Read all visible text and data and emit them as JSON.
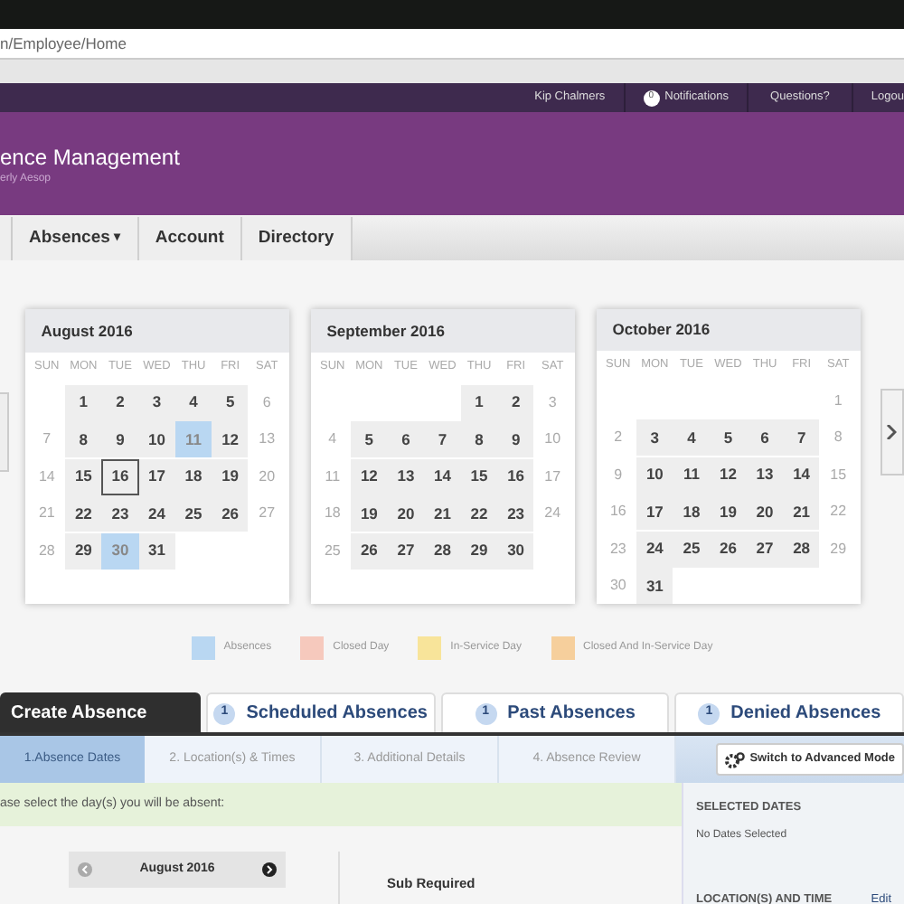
{
  "browser": {
    "address": "n/Employee/Home"
  },
  "top_nav": {
    "user": "Kip Chalmers",
    "notification_count": "0",
    "notifications": "Notifications",
    "questions": "Questions?",
    "logout": "Logou"
  },
  "header": {
    "title": "ence Management",
    "subtitle": "erly Aesop"
  },
  "nav_tabs": [
    {
      "label": "Absences",
      "caret": "▾"
    },
    {
      "label": "Account"
    },
    {
      "label": "Directory"
    }
  ],
  "calendars": [
    {
      "title": "August 2016",
      "weekdays": [
        "SUN",
        "MON",
        "TUE",
        "WED",
        "THU",
        "FRI",
        "SAT"
      ],
      "weeks": [
        [
          {
            "kind": "blank"
          },
          {
            "day": "1",
            "kind": "work"
          },
          {
            "day": "2",
            "kind": "work"
          },
          {
            "day": "3",
            "kind": "work"
          },
          {
            "day": "4",
            "kind": "work"
          },
          {
            "day": "5",
            "kind": "work"
          },
          {
            "day": "6",
            "kind": "weekend"
          }
        ],
        [
          {
            "day": "7",
            "kind": "weekend"
          },
          {
            "day": "8",
            "kind": "work"
          },
          {
            "day": "9",
            "kind": "work"
          },
          {
            "day": "10",
            "kind": "work"
          },
          {
            "day": "11",
            "kind": "absence"
          },
          {
            "day": "12",
            "kind": "work"
          },
          {
            "day": "13",
            "kind": "weekend"
          }
        ],
        [
          {
            "day": "14",
            "kind": "weekend"
          },
          {
            "day": "15",
            "kind": "work"
          },
          {
            "day": "16",
            "kind": "today"
          },
          {
            "day": "17",
            "kind": "work"
          },
          {
            "day": "18",
            "kind": "work"
          },
          {
            "day": "19",
            "kind": "work"
          },
          {
            "day": "20",
            "kind": "weekend"
          }
        ],
        [
          {
            "day": "21",
            "kind": "weekend"
          },
          {
            "day": "22",
            "kind": "work"
          },
          {
            "day": "23",
            "kind": "work"
          },
          {
            "day": "24",
            "kind": "work"
          },
          {
            "day": "25",
            "kind": "work"
          },
          {
            "day": "26",
            "kind": "work"
          },
          {
            "day": "27",
            "kind": "weekend"
          }
        ],
        [
          {
            "day": "28",
            "kind": "weekend"
          },
          {
            "day": "29",
            "kind": "work"
          },
          {
            "day": "30",
            "kind": "absence"
          },
          {
            "day": "31",
            "kind": "work"
          },
          {
            "kind": "blank"
          },
          {
            "kind": "blank"
          },
          {
            "kind": "blank"
          }
        ]
      ]
    },
    {
      "title": "September 2016",
      "weekdays": [
        "SUN",
        "MON",
        "TUE",
        "WED",
        "THU",
        "FRI",
        "SAT"
      ],
      "weeks": [
        [
          {
            "kind": "blank"
          },
          {
            "kind": "blank"
          },
          {
            "kind": "blank"
          },
          {
            "kind": "blank"
          },
          {
            "day": "1",
            "kind": "work"
          },
          {
            "day": "2",
            "kind": "work"
          },
          {
            "day": "3",
            "kind": "weekend"
          }
        ],
        [
          {
            "day": "4",
            "kind": "weekend"
          },
          {
            "day": "5",
            "kind": "work"
          },
          {
            "day": "6",
            "kind": "work"
          },
          {
            "day": "7",
            "kind": "work"
          },
          {
            "day": "8",
            "kind": "work"
          },
          {
            "day": "9",
            "kind": "work"
          },
          {
            "day": "10",
            "kind": "weekend"
          }
        ],
        [
          {
            "day": "11",
            "kind": "weekend"
          },
          {
            "day": "12",
            "kind": "work"
          },
          {
            "day": "13",
            "kind": "work"
          },
          {
            "day": "14",
            "kind": "work"
          },
          {
            "day": "15",
            "kind": "work"
          },
          {
            "day": "16",
            "kind": "work"
          },
          {
            "day": "17",
            "kind": "weekend"
          }
        ],
        [
          {
            "day": "18",
            "kind": "weekend"
          },
          {
            "day": "19",
            "kind": "work"
          },
          {
            "day": "20",
            "kind": "work"
          },
          {
            "day": "21",
            "kind": "work"
          },
          {
            "day": "22",
            "kind": "work"
          },
          {
            "day": "23",
            "kind": "work"
          },
          {
            "day": "24",
            "kind": "weekend"
          }
        ],
        [
          {
            "day": "25",
            "kind": "weekend"
          },
          {
            "day": "26",
            "kind": "work"
          },
          {
            "day": "27",
            "kind": "work"
          },
          {
            "day": "28",
            "kind": "work"
          },
          {
            "day": "29",
            "kind": "work"
          },
          {
            "day": "30",
            "kind": "work"
          },
          {
            "kind": "blank"
          }
        ]
      ]
    },
    {
      "title": "October 2016",
      "weekdays": [
        "SUN",
        "MON",
        "TUE",
        "WED",
        "THU",
        "FRI",
        "SAT"
      ],
      "weeks": [
        [
          {
            "kind": "blank"
          },
          {
            "kind": "blank"
          },
          {
            "kind": "blank"
          },
          {
            "kind": "blank"
          },
          {
            "kind": "blank"
          },
          {
            "kind": "blank"
          },
          {
            "day": "1",
            "kind": "weekend"
          }
        ],
        [
          {
            "day": "2",
            "kind": "weekend"
          },
          {
            "day": "3",
            "kind": "work"
          },
          {
            "day": "4",
            "kind": "work"
          },
          {
            "day": "5",
            "kind": "work"
          },
          {
            "day": "6",
            "kind": "work"
          },
          {
            "day": "7",
            "kind": "work"
          },
          {
            "day": "8",
            "kind": "weekend"
          }
        ],
        [
          {
            "day": "9",
            "kind": "weekend"
          },
          {
            "day": "10",
            "kind": "work"
          },
          {
            "day": "11",
            "kind": "work"
          },
          {
            "day": "12",
            "kind": "work"
          },
          {
            "day": "13",
            "kind": "work"
          },
          {
            "day": "14",
            "kind": "work"
          },
          {
            "day": "15",
            "kind": "weekend"
          }
        ],
        [
          {
            "day": "16",
            "kind": "weekend"
          },
          {
            "day": "17",
            "kind": "work"
          },
          {
            "day": "18",
            "kind": "work"
          },
          {
            "day": "19",
            "kind": "work"
          },
          {
            "day": "20",
            "kind": "work"
          },
          {
            "day": "21",
            "kind": "work"
          },
          {
            "day": "22",
            "kind": "weekend"
          }
        ],
        [
          {
            "day": "23",
            "kind": "weekend"
          },
          {
            "day": "24",
            "kind": "work"
          },
          {
            "day": "25",
            "kind": "work"
          },
          {
            "day": "26",
            "kind": "work"
          },
          {
            "day": "27",
            "kind": "work"
          },
          {
            "day": "28",
            "kind": "work"
          },
          {
            "day": "29",
            "kind": "weekend"
          }
        ],
        [
          {
            "day": "30",
            "kind": "weekend"
          },
          {
            "day": "31",
            "kind": "work"
          },
          {
            "kind": "blank"
          },
          {
            "kind": "blank"
          },
          {
            "kind": "blank"
          },
          {
            "kind": "blank"
          },
          {
            "kind": "blank"
          }
        ]
      ]
    }
  ],
  "legend": [
    {
      "label": "Absences",
      "color": "#b9d7f2"
    },
    {
      "label": "Closed Day",
      "color": "#f6c9bd"
    },
    {
      "label": "In-Service Day",
      "color": "#f8e49a"
    },
    {
      "label": "Closed And In-Service Day",
      "color": "#f6cf9c"
    }
  ],
  "absence_tabs": [
    {
      "label": "Create Absence",
      "selected": true
    },
    {
      "label": "Scheduled Absences",
      "count": "1",
      "selected": false
    },
    {
      "label": "Past Absences",
      "count": "1",
      "selected": false
    },
    {
      "label": "Denied Absences",
      "count": "1",
      "selected": false
    }
  ],
  "steps": [
    {
      "label": "1.Absence Dates",
      "selected": true
    },
    {
      "label": "2. Location(s) & Times",
      "selected": false
    },
    {
      "label": "3. Additional Details",
      "selected": false
    },
    {
      "label": "4. Absence Review",
      "selected": false
    }
  ],
  "advanced_button": "Switch to Advanced Mode",
  "instruction": "ase select the day(s) you will be absent:",
  "mini_calendar": {
    "title": "August 2016"
  },
  "sub_required": "Sub Required",
  "side_panel": {
    "selected_dates_heading": "SELECTED DATES",
    "selected_dates_value": "No Dates Selected",
    "location_heading": "LOCATION(S) AND TIME",
    "edit_link": "Edit"
  }
}
